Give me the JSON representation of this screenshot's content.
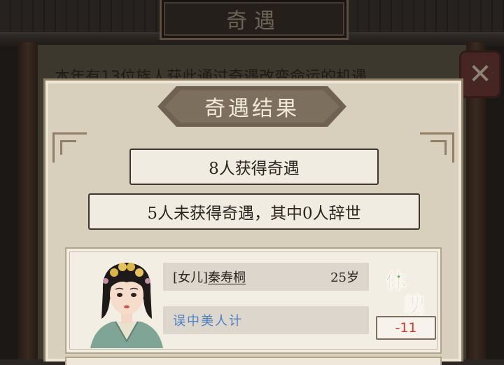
{
  "background": {
    "window_title": "奇遇",
    "intro_text": "本年有13位族人获此通过奇遇改变命运的机遇",
    "close_icon": "close-x-icon"
  },
  "modal": {
    "title": "奇遇结果",
    "gained_text": "8人获得奇遇",
    "missed_text": "5人未获得奇遇，其中0人辞世"
  },
  "character": {
    "relation": "[女儿]",
    "name": "秦寿桐",
    "age": "25岁",
    "event": "误中美人计",
    "stat_char_1": "体",
    "stat_char_2": "魄",
    "stat_change": "-11"
  },
  "colors": {
    "stat_green": "#4f9a38",
    "delta_red": "#d0392f",
    "event_blue": "#4a7fc4"
  }
}
